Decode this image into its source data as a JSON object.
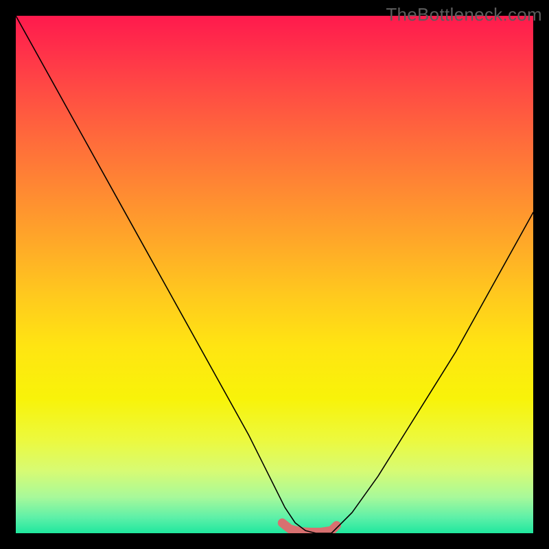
{
  "watermark": "TheBottleneck.com",
  "chart_data": {
    "type": "line",
    "title": "",
    "xlabel": "",
    "ylabel": "",
    "xlim": [
      0,
      100
    ],
    "ylim": [
      0,
      100
    ],
    "grid": false,
    "legend": false,
    "note": "Background vertical gradient maps z from 100 (top, red) to 0 (bottom, green). Curve y is the main series; minimum plateau ≈0 highlighted in coral.",
    "series": [
      {
        "name": "curve",
        "x": [
          0,
          5,
          10,
          15,
          20,
          25,
          30,
          35,
          40,
          45,
          50,
          52,
          54,
          56,
          58,
          60,
          61,
          62,
          65,
          70,
          75,
          80,
          85,
          90,
          95,
          100
        ],
        "y": [
          100,
          91,
          82,
          73,
          64,
          55,
          46,
          37,
          28,
          19,
          9,
          5,
          2,
          0.5,
          0,
          0,
          0,
          1,
          4,
          11,
          19,
          27,
          35,
          44,
          53,
          62
        ]
      },
      {
        "name": "highlight-plateau",
        "x": [
          51.5,
          53,
          55,
          57,
          59,
          61,
          62
        ],
        "y": [
          2,
          0.8,
          0.3,
          0.2,
          0.2,
          0.5,
          1.5
        ]
      }
    ],
    "background_gradient_stops": [
      {
        "pos": 0,
        "color": "#ff1a4d"
      },
      {
        "pos": 14,
        "color": "#ff4a44"
      },
      {
        "pos": 34,
        "color": "#ff8a32"
      },
      {
        "pos": 54,
        "color": "#ffc91e"
      },
      {
        "pos": 74,
        "color": "#f8f309"
      },
      {
        "pos": 88,
        "color": "#d7fb74"
      },
      {
        "pos": 100,
        "color": "#1fe79e"
      }
    ]
  }
}
